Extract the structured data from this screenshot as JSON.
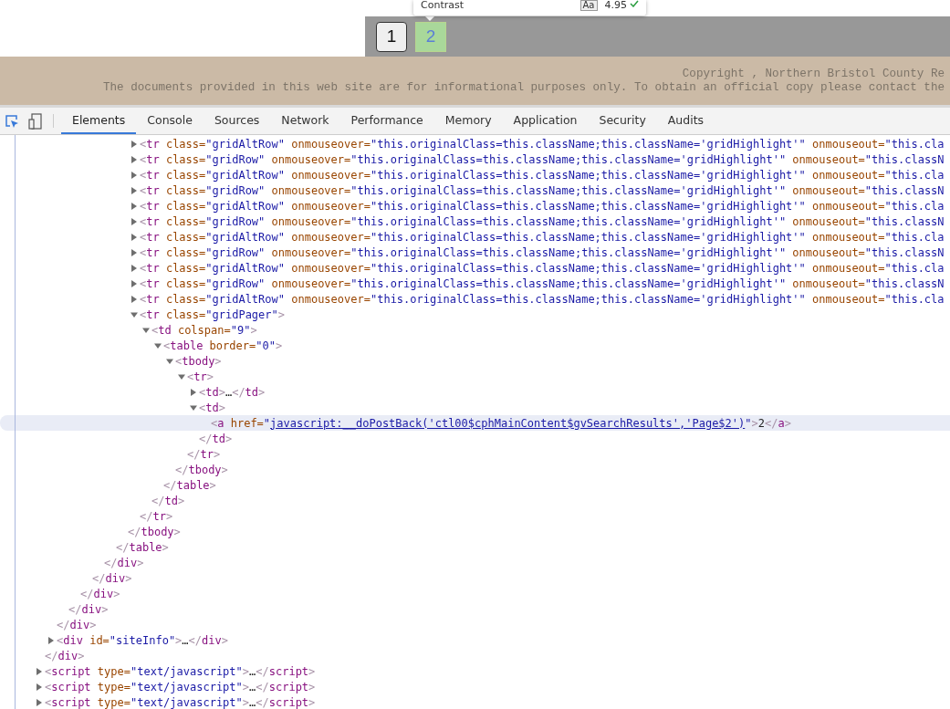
{
  "tooltip": {
    "label": "Contrast",
    "badge": "Aa",
    "ratio": "4.95",
    "passes": true
  },
  "pager": {
    "pages": [
      {
        "label": "1",
        "selected": false
      },
      {
        "label": "2",
        "selected": true
      }
    ]
  },
  "footer": {
    "lines": [
      "Copyright , Northern Bristol County Re",
      "The documents provided in this web site are for informational purposes only. To obtain an official copy please contact the"
    ]
  },
  "devtools": {
    "inspect_active": true,
    "tabs": [
      {
        "label": "Elements",
        "selected": true
      },
      {
        "label": "Console",
        "selected": false
      },
      {
        "label": "Sources",
        "selected": false
      },
      {
        "label": "Network",
        "selected": false
      },
      {
        "label": "Performance",
        "selected": false
      },
      {
        "label": "Memory",
        "selected": false
      },
      {
        "label": "Application",
        "selected": false
      },
      {
        "label": "Security",
        "selected": false
      },
      {
        "label": "Audits",
        "selected": false
      }
    ]
  },
  "dom_tree": [
    {
      "close": "</div>",
      "children": [
        {
          "close": "</div>",
          "children": [
            {
              "close": "</div>",
              "children": [
                {
                  "close": "</div>",
                  "children": [
                    {
                      "close": "</div>",
                      "children": [
                        {
                          "close": "</div>",
                          "children": [
                            {
                              "close": "</table>",
                              "children": [
                                {
                                  "close": "</tbody>",
                                  "children": [
                                    {
                                      "open": "<tr class=\"gridAltRow\" onmouseover=\"this.originalClass=this.className;this.className='gridHighlight'\" onmouseout=\"this.cla",
                                      "expanded": false,
                                      "selected": false
                                    },
                                    {
                                      "open": "<tr class=\"gridRow\" onmouseover=\"this.originalClass=this.className;this.className='gridHighlight'\" onmouseout=\"this.classN",
                                      "expanded": false,
                                      "selected": false
                                    },
                                    {
                                      "open": "<tr class=\"gridAltRow\" onmouseover=\"this.originalClass=this.className;this.className='gridHighlight'\" onmouseout=\"this.cla",
                                      "expanded": false,
                                      "selected": false
                                    },
                                    {
                                      "open": "<tr class=\"gridRow\" onmouseover=\"this.originalClass=this.className;this.className='gridHighlight'\" onmouseout=\"this.classN",
                                      "expanded": false,
                                      "selected": false
                                    },
                                    {
                                      "open": "<tr class=\"gridAltRow\" onmouseover=\"this.originalClass=this.className;this.className='gridHighlight'\" onmouseout=\"this.cla",
                                      "expanded": false,
                                      "selected": false
                                    },
                                    {
                                      "open": "<tr class=\"gridRow\" onmouseover=\"this.originalClass=this.className;this.className='gridHighlight'\" onmouseout=\"this.classN",
                                      "expanded": false,
                                      "selected": false
                                    },
                                    {
                                      "open": "<tr class=\"gridAltRow\" onmouseover=\"this.originalClass=this.className;this.className='gridHighlight'\" onmouseout=\"this.cla",
                                      "expanded": false,
                                      "selected": false
                                    },
                                    {
                                      "open": "<tr class=\"gridRow\" onmouseover=\"this.originalClass=this.className;this.className='gridHighlight'\" onmouseout=\"this.classN",
                                      "expanded": false,
                                      "selected": false
                                    },
                                    {
                                      "open": "<tr class=\"gridAltRow\" onmouseover=\"this.originalClass=this.className;this.className='gridHighlight'\" onmouseout=\"this.cla",
                                      "expanded": false,
                                      "selected": false
                                    },
                                    {
                                      "open": "<tr class=\"gridRow\" onmouseover=\"this.originalClass=this.className;this.className='gridHighlight'\" onmouseout=\"this.classN",
                                      "expanded": false,
                                      "selected": false
                                    },
                                    {
                                      "open": "<tr class=\"gridAltRow\" onmouseover=\"this.originalClass=this.className;this.className='gridHighlight'\" onmouseout=\"this.cla",
                                      "expanded": false,
                                      "selected": false
                                    },
                                    {
                                      "open": "<tr class=\"gridPager\">",
                                      "close": "</tr>",
                                      "expanded": true,
                                      "selected": false,
                                      "children": [
                                        {
                                          "open": "<td colspan=\"9\">",
                                          "close": "</td>",
                                          "expanded": true,
                                          "selected": false,
                                          "children": [
                                            {
                                              "open": "<table border=\"0\">",
                                              "close": "</table>",
                                              "expanded": true,
                                              "selected": false,
                                              "children": [
                                                {
                                                  "open": "<tbody>",
                                                  "close": "</tbody>",
                                                  "expanded": true,
                                                  "selected": false,
                                                  "children": [
                                                    {
                                                      "open": "<tr>",
                                                      "close": "</tr>",
                                                      "expanded": true,
                                                      "selected": false,
                                                      "children": [
                                                        {
                                                          "open": "<td>…</td>",
                                                          "expanded": false,
                                                          "selected": false
                                                        },
                                                        {
                                                          "open": "<td>",
                                                          "close": "</td>",
                                                          "expanded": true,
                                                          "selected": false,
                                                          "children": [
                                                            {
                                                              "open": "<a href=\"javascript:__doPostBack('ctl00$cphMainContent$gvSearchResults','Page$2')\">2</a>",
                                                              "link": true,
                                                              "selected": true
                                                            }
                                                          ]
                                                        }
                                                      ]
                                                    }
                                                  ]
                                                }
                                              ]
                                            }
                                          ]
                                        }
                                      ]
                                    }
                                  ]
                                }
                              ]
                            }
                          ]
                        }
                      ]
                    }
                  ]
                }
              ]
            }
          ]
        },
        {
          "open": "<div id=\"siteInfo\">…</div>",
          "expanded": false,
          "selected": false
        }
      ]
    },
    {
      "open": "<script type=\"text/javascript\">…</script>",
      "expanded": false,
      "selected": false
    },
    {
      "open": "<script type=\"text/javascript\">…</script>",
      "expanded": false,
      "selected": false
    },
    {
      "open": "<script type=\"text/javascript\">…</script>",
      "expanded": false,
      "selected": false
    }
  ]
}
